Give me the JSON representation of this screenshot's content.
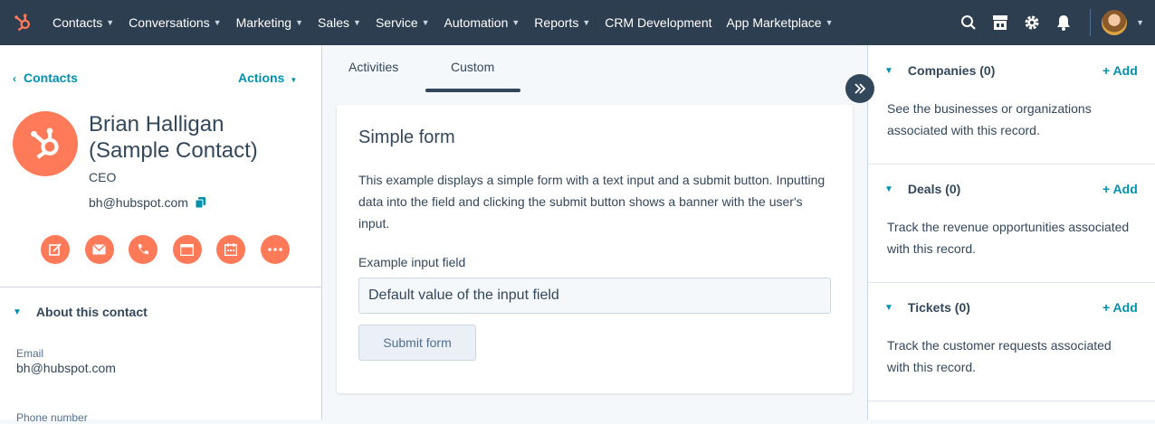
{
  "nav": {
    "items": [
      {
        "label": "Contacts",
        "dropdown": true
      },
      {
        "label": "Conversations",
        "dropdown": true
      },
      {
        "label": "Marketing",
        "dropdown": true
      },
      {
        "label": "Sales",
        "dropdown": true
      },
      {
        "label": "Service",
        "dropdown": true
      },
      {
        "label": "Automation",
        "dropdown": true
      },
      {
        "label": "Reports",
        "dropdown": true
      },
      {
        "label": "CRM Development",
        "dropdown": false
      },
      {
        "label": "App Marketplace",
        "dropdown": true
      }
    ],
    "icons": [
      "search-icon",
      "marketplace-icon",
      "gear-icon",
      "bell-icon"
    ]
  },
  "left": {
    "back_label": "Contacts",
    "actions_label": "Actions",
    "contact_name": "Brian Halligan (Sample Contact)",
    "contact_title": "CEO",
    "contact_email": "bh@hubspot.com",
    "action_icons": [
      "note-icon",
      "email-icon",
      "call-icon",
      "task-icon",
      "meeting-icon",
      "more-icon"
    ],
    "about_title": "About this contact",
    "email_label": "Email",
    "email_value": "bh@hubspot.com",
    "phone_label": "Phone number"
  },
  "middle": {
    "tabs": [
      "Activities",
      "Custom"
    ],
    "active_tab": "Custom",
    "card_title": "Simple form",
    "card_desc": "This example displays a simple form with a text input and a submit button. Inputting data into the field and clicking the submit button shows a banner with the user's input.",
    "input_label": "Example input field",
    "input_value": "Default value of the input field",
    "submit_label": "Submit form"
  },
  "right": {
    "sections": [
      {
        "title": "Companies (0)",
        "add": "+ Add",
        "desc": "See the businesses or organizations associated with this record."
      },
      {
        "title": "Deals (0)",
        "add": "+ Add",
        "desc": "Track the revenue opportunities associated with this record."
      },
      {
        "title": "Tickets (0)",
        "add": "+ Add",
        "desc": "Track the customer requests associated with this record."
      }
    ]
  },
  "colors": {
    "nav_bg": "#2d3e50",
    "accent": "#ff7a59",
    "link": "#0091ae"
  }
}
